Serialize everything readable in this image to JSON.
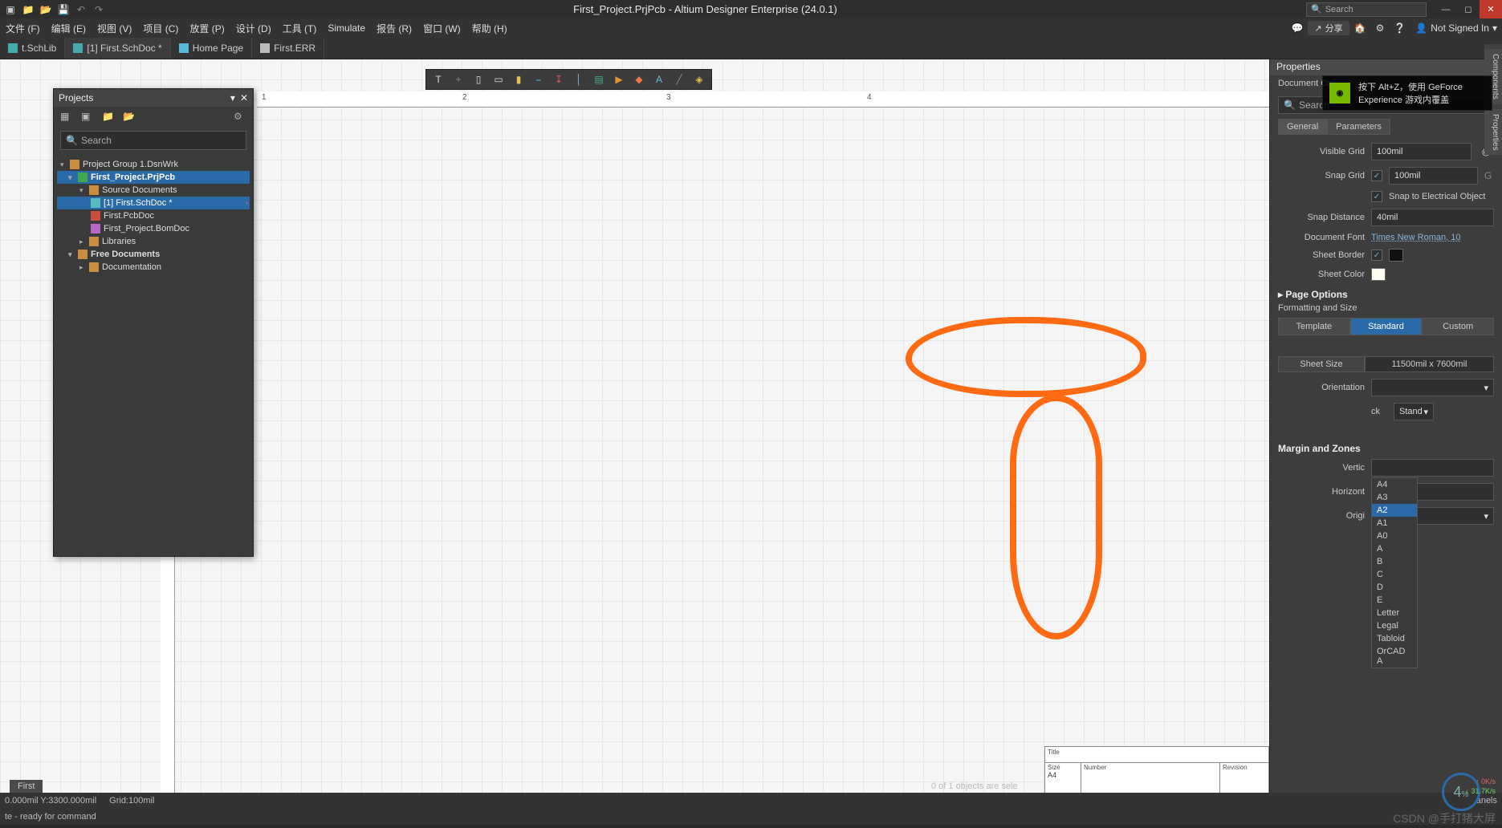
{
  "title": "First_Project.PrjPcb - Altium Designer Enterprise (24.0.1)",
  "search_placeholder": "Search",
  "menu": {
    "file": "文件 (F)",
    "edit": "编辑 (E)",
    "view": "视图 (V)",
    "project": "项目 (C)",
    "place": "放置 (P)",
    "design": "设计 (D)",
    "tools": "工具 (T)",
    "simulate": "Simulate",
    "report": "报告 (R)",
    "window": "窗口 (W)",
    "help": "帮助 (H)",
    "share": "分享",
    "signin": "Not Signed In"
  },
  "doc_tabs": {
    "t0": "t.SchLib",
    "t1": "[1] First.SchDoc *",
    "t2": "Home Page",
    "t3": "First.ERR"
  },
  "ruler": {
    "r1": "1",
    "r2": "2",
    "r3": "3",
    "r4": "4"
  },
  "titleblock": {
    "title_lbl": "Title",
    "size_lbl": "Size",
    "size_val": "A4",
    "num_lbl": "Number",
    "rev_lbl": "Revision"
  },
  "projects": {
    "panel_title": "Projects",
    "search_placeholder": "Search",
    "group": "Project Group 1.DsnWrk",
    "project": "First_Project.PrjPcb",
    "src": "Source Documents",
    "sch": "[1] First.SchDoc *",
    "pcb": "First.PcbDoc",
    "bom": "First_Project.BomDoc",
    "libs": "Libraries",
    "free": "Free Documents",
    "docu": "Documentation"
  },
  "props": {
    "panel_title": "Properties",
    "subtitle": "Document Op",
    "search_placeholder": "Search",
    "tab_general": "General",
    "tab_params": "Parameters",
    "visible_grid_lbl": "Visible Grid",
    "visible_grid": "100mil",
    "snap_grid_lbl": "Snap Grid",
    "snap_grid": "100mil",
    "snap_grid_key": "G",
    "snap_elec": "Snap to Electrical Object",
    "snap_dist_lbl": "Snap Distance",
    "snap_dist": "40mil",
    "font_lbl": "Document Font",
    "font": "Times New Roman, 10",
    "border_lbl": "Sheet Border",
    "color_lbl": "Sheet Color",
    "page_options": "Page Options",
    "fmt_size": "Formatting and Size",
    "btn_template": "Template",
    "btn_standard": "Standard",
    "btn_custom": "Custom",
    "sheet_size_lbl": "Sheet Size",
    "sheet_dims": "11500mil x 7600mil",
    "orientation_lbl": "Orientation",
    "titleblk_std": "Stand",
    "titleblk_suffix": "ck",
    "margin": "Margin and Zones",
    "vertical": "Vertic",
    "horizontal": "Horizont",
    "origin": "Origi"
  },
  "dropdown": {
    "o0": "A4",
    "o1": "A3",
    "o2": "A2",
    "o3": "A1",
    "o4": "A0",
    "o5": "A",
    "o6": "B",
    "o7": "C",
    "o8": "D",
    "o9": "E",
    "o10": "Letter",
    "o11": "Legal",
    "o12": "Tabloid",
    "o13": "OrCAD A"
  },
  "nvidia": {
    "line1": "按下 Alt+Z，使用 GeForce",
    "line2": "Experience 游戏内覆盖"
  },
  "net": {
    "pct": "4",
    "unit": "%",
    "up": "0K/s",
    "down": "31.7K/s"
  },
  "side_tabs": {
    "comp": "Components",
    "props": "Properties"
  },
  "status": {
    "coords": "0.000mil Y:3300.000mil",
    "grid": "Grid:100mil",
    "ready": "te - ready for command",
    "sel": "0 of 1 objects are sele",
    "panels": "anels",
    "bottom_tab": "First"
  },
  "watermark": "CSDN @手打猪大屏"
}
